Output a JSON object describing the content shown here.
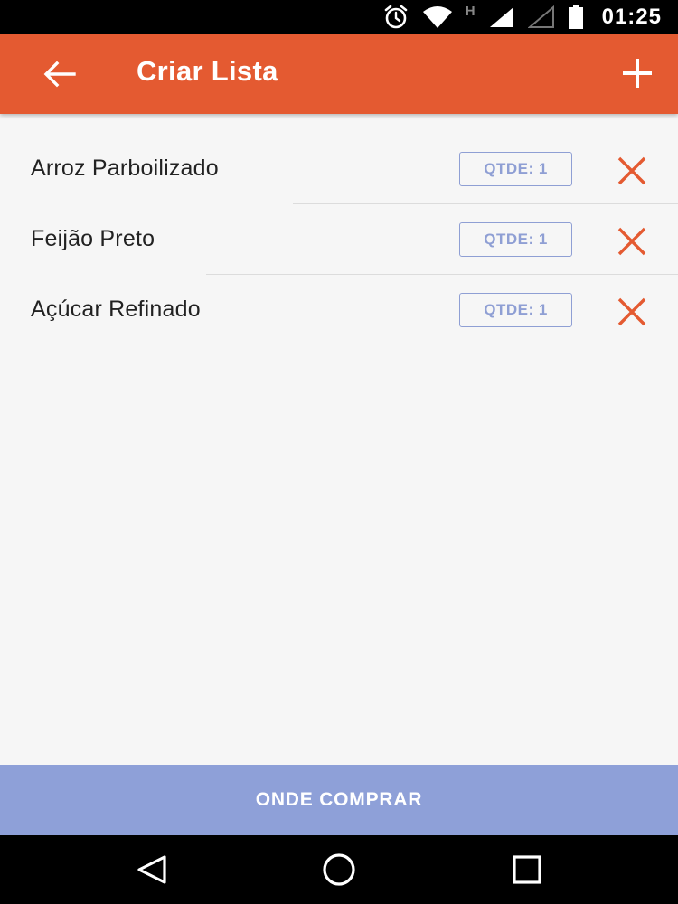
{
  "status_bar": {
    "network_type": "H",
    "time": "01:25",
    "icons": [
      "alarm-icon",
      "wifi-icon",
      "signal-icon",
      "signal-empty-icon",
      "battery-icon"
    ]
  },
  "app_bar": {
    "title": "Criar Lista",
    "back_icon": "arrow-left-icon",
    "add_icon": "plus-icon"
  },
  "items": [
    {
      "name": "Arroz Parboilizado",
      "qty_label": "QTDE: 1"
    },
    {
      "name": "Feijão Preto",
      "qty_label": "QTDE: 1"
    },
    {
      "name": "Açúcar Refinado",
      "qty_label": "QTDE: 1"
    }
  ],
  "footer": {
    "action_label": "ONDE COMPRAR"
  },
  "colors": {
    "primary": "#e45a31",
    "accent": "#8ea0d8",
    "remove": "#e45a31"
  }
}
